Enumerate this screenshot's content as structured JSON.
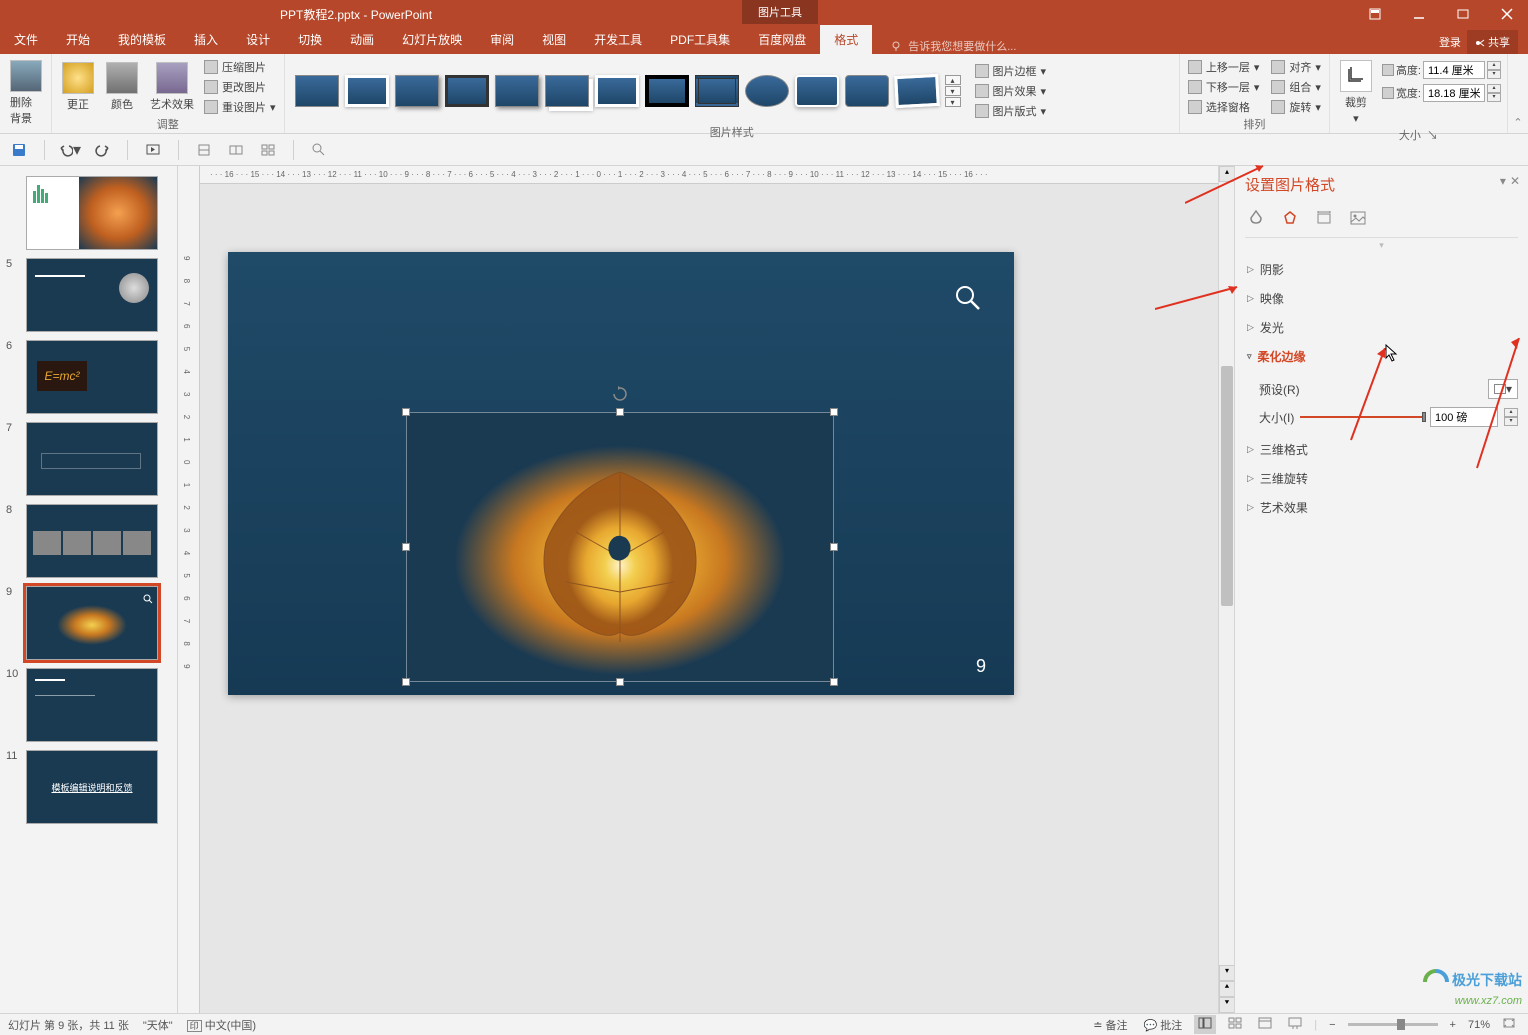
{
  "title": {
    "doc": "PPT教程2.pptx",
    "app": "PowerPoint",
    "tool_tab": "图片工具"
  },
  "tabs": {
    "file": "文件",
    "home": "开始",
    "template": "我的模板",
    "insert": "插入",
    "design": "设计",
    "transition": "切换",
    "animation": "动画",
    "slideshow": "幻灯片放映",
    "review": "审阅",
    "view": "视图",
    "developer": "开发工具",
    "pdftools": "PDF工具集",
    "baidu": "百度网盘",
    "format": "格式"
  },
  "tellme": "告诉我您想要做什么...",
  "login": "登录",
  "share": "共享",
  "ribbon": {
    "remove_bg": "删除背景",
    "corrections": "更正",
    "color": "颜色",
    "artistic": "艺术效果",
    "compress": "压缩图片",
    "change": "更改图片",
    "reset": "重设图片",
    "adjust_group": "调整",
    "styles_group": "图片样式",
    "border": "图片边框",
    "effects": "图片效果",
    "layout": "图片版式",
    "bring_forward": "上移一层",
    "send_backward": "下移一层",
    "selection_pane": "选择窗格",
    "align": "对齐",
    "group": "组合",
    "rotate": "旋转",
    "arrange_group": "排列",
    "crop": "裁剪",
    "height_label": "高度:",
    "width_label": "宽度:",
    "height_val": "11.4 厘米",
    "width_val": "18.18 厘米",
    "size_group": "大小"
  },
  "ruler_h": "· · · 16 · · · 15 · · · 14 · · · 13 · · · 12 · · · 11 · · · 10 · · · 9 · · · 8 · · · 7 · · · 6 · · · 5 · · · 4 · · · 3 · · · 2 · · · 1 · · · 0 · · · 1 · · · 2 · · · 3 · · · 4 · · · 5 · · · 6 · · · 7 · · · 8 · · · 9 · · · 10 · · · 11 · · · 12 · · · 13 · · · 14 · · · 15 · · · 16 · · ·",
  "slides": [
    {
      "n": "",
      "type": "chart"
    },
    {
      "n": "5",
      "type": "einstein"
    },
    {
      "n": "6",
      "type": "emc2"
    },
    {
      "n": "7",
      "type": "text"
    },
    {
      "n": "8",
      "type": "photos"
    },
    {
      "n": "9",
      "type": "leaf",
      "selected": true
    },
    {
      "n": "10",
      "type": "text2"
    },
    {
      "n": "11",
      "type": "title"
    }
  ],
  "slide11_text": "模板编辑说明和反馈",
  "current_slide_num": "9",
  "format_panel": {
    "title": "设置图片格式",
    "shadow": "阴影",
    "reflection": "映像",
    "glow": "发光",
    "soft_edges": "柔化边缘",
    "preset": "预设(R)",
    "size": "大小(I)",
    "size_val": "100 磅",
    "format_3d": "三维格式",
    "rotation_3d": "三维旋转",
    "artistic": "艺术效果"
  },
  "status": {
    "slide_info": "幻灯片 第 9 张，共 11 张",
    "theme": "\"天体\"",
    "lang_icon": "印",
    "lang": "中文(中国)",
    "notes": "备注",
    "comments": "批注",
    "zoom": "71%"
  },
  "watermark": {
    "line1": "极光下载站",
    "line2": "www.xz7.com"
  }
}
